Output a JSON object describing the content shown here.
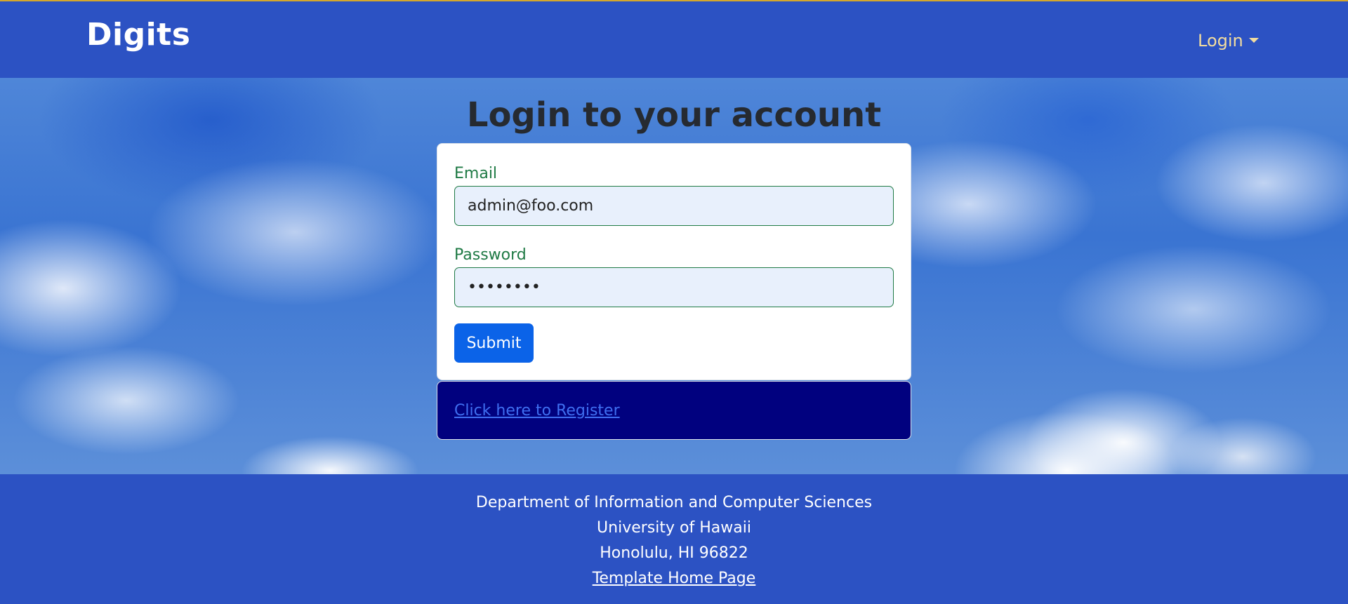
{
  "navbar": {
    "brand": "Digits",
    "login_menu": "Login"
  },
  "page": {
    "title": "Login to your account"
  },
  "form": {
    "email_label": "Email",
    "email_value": "admin@foo.com",
    "password_label": "Password",
    "password_value": "••••••••",
    "submit_label": "Submit"
  },
  "register": {
    "link_text": "Click here to Register"
  },
  "footer": {
    "line1": "Department of Information and Computer Sciences",
    "line2": "University of Hawaii",
    "line3": "Honolulu, HI 96822",
    "link_text": "Template Home Page"
  },
  "colors": {
    "navbar_bg": "#2c52c3",
    "login_text": "#f3dd9e",
    "label_green": "#1f7a45",
    "submit_blue": "#0b63e8",
    "register_bg": "#01017f"
  }
}
